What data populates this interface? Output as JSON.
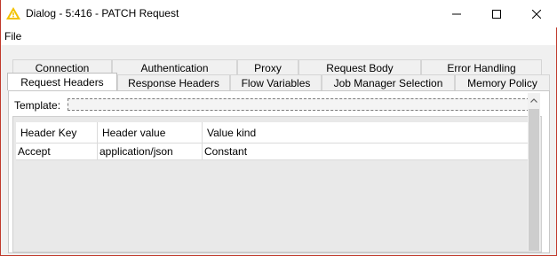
{
  "window": {
    "title": "Dialog - 5:416 - PATCH Request",
    "icon": "knime-warning-triangle-icon",
    "accent_color": "#c0392b"
  },
  "menu": {
    "file": "File"
  },
  "tabs_row1": [
    "Connection",
    "Authentication",
    "Proxy",
    "Request Body",
    "Error Handling"
  ],
  "tabs_row2": [
    "Request Headers",
    "Response Headers",
    "Flow Variables",
    "Job Manager Selection",
    "Memory Policy"
  ],
  "selected_tab": "Request Headers",
  "template": {
    "label": "Template:",
    "value": ""
  },
  "table": {
    "columns": [
      "Header Key",
      "Header value",
      "Value kind"
    ],
    "rows": [
      [
        "Accept",
        "application/json",
        "Constant"
      ]
    ]
  }
}
